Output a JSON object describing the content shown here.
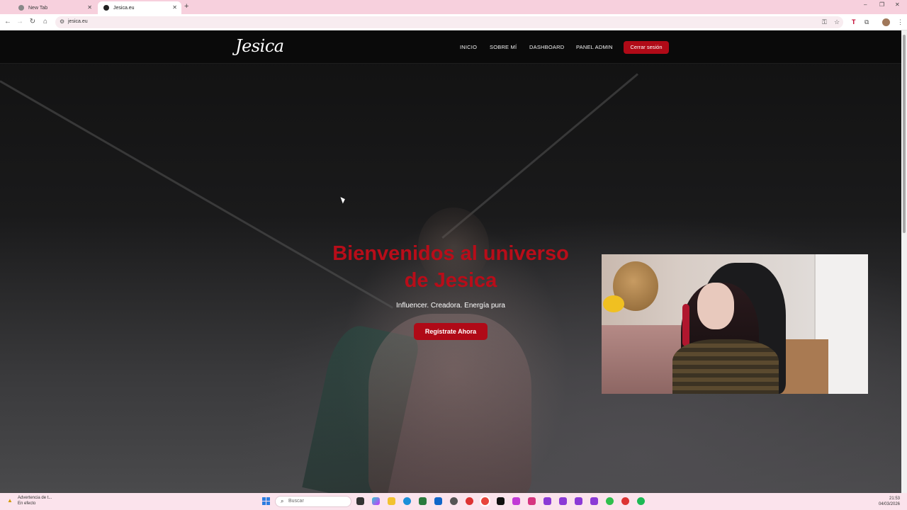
{
  "browser": {
    "tabs": [
      {
        "title": "New Tab",
        "active": false
      },
      {
        "title": "Jesica.eu",
        "active": true
      }
    ],
    "new_tab_icon": "+",
    "url": "jesica.eu",
    "window_controls": {
      "minimize": "–",
      "restore": "❐",
      "close": "✕"
    },
    "nav_icons": {
      "back": "←",
      "forward": "→",
      "reload": "↻",
      "home": "⌂",
      "tune": "⚙"
    },
    "toolbar_icons": {
      "key": "⚿",
      "star": "☆",
      "ext1": "T",
      "extensions": "⧉",
      "menu": "⋮"
    }
  },
  "site": {
    "logo": "Jesica",
    "nav": [
      "INICIO",
      "SOBRE MÍ",
      "DASHBOARD",
      "PANEL ADMIN"
    ],
    "logout_button": "Cerrar sesión",
    "hero": {
      "title_line1": "Bienvenidos al universo",
      "title_line2": "de Jesica",
      "subtitle": "Influencer. Creadora. Energía pura",
      "cta": "Regístrate Ahora"
    },
    "accent_color": "#b00a17"
  },
  "taskbar": {
    "notification_title": "Advertencia de t...",
    "notification_sub": "En efecto",
    "search_placeholder": "Buscar",
    "time": "21:53",
    "date": "04/03/2026",
    "apps": [
      "file-explorer-icon",
      "copilot-icon",
      "edge-icon",
      "folder-icon",
      "store-icon",
      "outlook-icon",
      "chrome-icon",
      "obs-icon",
      "chrome-active-icon",
      "capcut-icon",
      "instagram-icon",
      "photos-icon",
      "app-icon-1",
      "app-icon-2",
      "app-icon-3",
      "app-icon-4",
      "whatsapp-icon",
      "chrome-alt-icon",
      "spotify-icon"
    ]
  }
}
